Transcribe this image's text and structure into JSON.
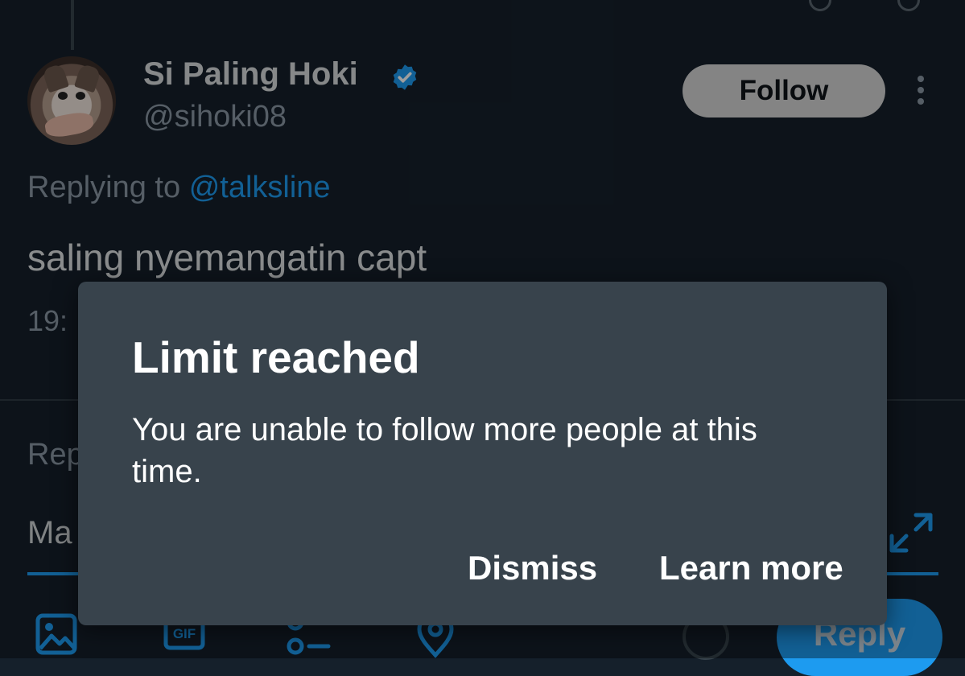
{
  "tweet": {
    "display_name": "Si Paling Hoki",
    "handle": "@sihoki08",
    "follow_label": "Follow",
    "replying_prefix": "Replying to",
    "replying_handle": "@talksline",
    "text": "saling nyemangatin capt",
    "time_partial": "19:"
  },
  "composer": {
    "reply_label_partial": "Rep",
    "input_partial": "Ma",
    "reply_button": "Reply"
  },
  "dialog": {
    "title": "Limit reached",
    "body": "You are unable to follow more people at this time.",
    "dismiss_label": "Dismiss",
    "learn_more_label": "Learn more"
  },
  "colors": {
    "background": "#15202b",
    "accent": "#1d9bf0",
    "dialog": "#38434c"
  },
  "icons": [
    "verified-badge-icon",
    "more-options-icon",
    "expand-icon",
    "image-icon",
    "gif-icon",
    "poll-icon",
    "location-icon"
  ]
}
